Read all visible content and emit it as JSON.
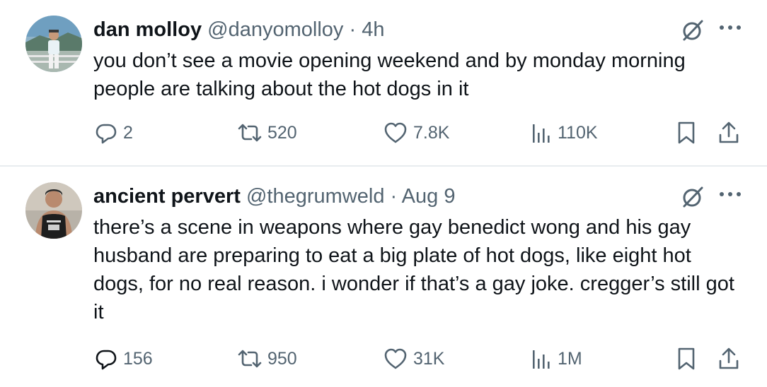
{
  "tweets": [
    {
      "name": "dan molloy",
      "handle": "@danyomolloy",
      "separator": "·",
      "time": "4h",
      "text": "you don’t see a movie opening weekend and by monday morning people are talking about the hot dogs in it",
      "replies": "2",
      "retweets": "520",
      "likes": "7.8K",
      "views": "110K"
    },
    {
      "name": "ancient pervert",
      "handle": "@thegrumweld",
      "separator": "·",
      "time": "Aug 9",
      "text": "there’s a scene in weapons where gay benedict wong and his gay husband are preparing to eat a big plate of hot dogs, like eight hot dogs, for no real reason. i wonder if that’s a gay joke. cregger’s still got it",
      "replies": "156",
      "retweets": "950",
      "likes": "31K",
      "views": "1M"
    }
  ],
  "icons": {
    "reply": "reply-icon",
    "retweet": "retweet-icon",
    "like": "heart-icon",
    "views": "views-icon",
    "bookmark": "bookmark-icon",
    "share": "share-icon",
    "grok": "grok-icon",
    "more": "more-icon"
  },
  "colors": {
    "text": "#0f1419",
    "secondary": "#536471",
    "divider": "#e8ecef"
  }
}
